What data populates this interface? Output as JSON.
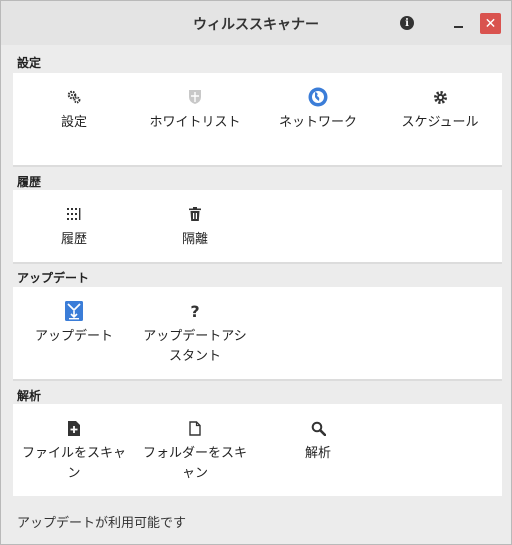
{
  "window": {
    "title": "ウィルススキャナー"
  },
  "titlebar": {
    "info_glyph": "i",
    "close_glyph": "✕"
  },
  "sections": {
    "settings": {
      "heading": "設定",
      "items": [
        {
          "label": "設定",
          "icon": "gears-icon"
        },
        {
          "label": "ホワイトリスト",
          "icon": "shield-icon"
        },
        {
          "label": "ネットワーク",
          "icon": "globe-icon"
        },
        {
          "label": "スケジュール",
          "icon": "gear-icon"
        }
      ]
    },
    "history": {
      "heading": "履歴",
      "items": [
        {
          "label": "履歴",
          "icon": "list-icon"
        },
        {
          "label": "隔離",
          "icon": "trash-icon"
        }
      ]
    },
    "update": {
      "heading": "アップデート",
      "items": [
        {
          "label": "アップデート",
          "icon": "download-icon"
        },
        {
          "label": "アップデートアシスタント",
          "icon": "question-icon"
        }
      ]
    },
    "analysis": {
      "heading": "解析",
      "items": [
        {
          "label": "ファイルをスキャン",
          "icon": "file-add-icon"
        },
        {
          "label": "フォルダーをスキャン",
          "icon": "file-icon"
        },
        {
          "label": "解析",
          "icon": "search-icon"
        }
      ]
    }
  },
  "status": {
    "text": "アップデートが利用可能です"
  },
  "colors": {
    "accent": "#3b7dd8",
    "close": "#d9534f"
  }
}
